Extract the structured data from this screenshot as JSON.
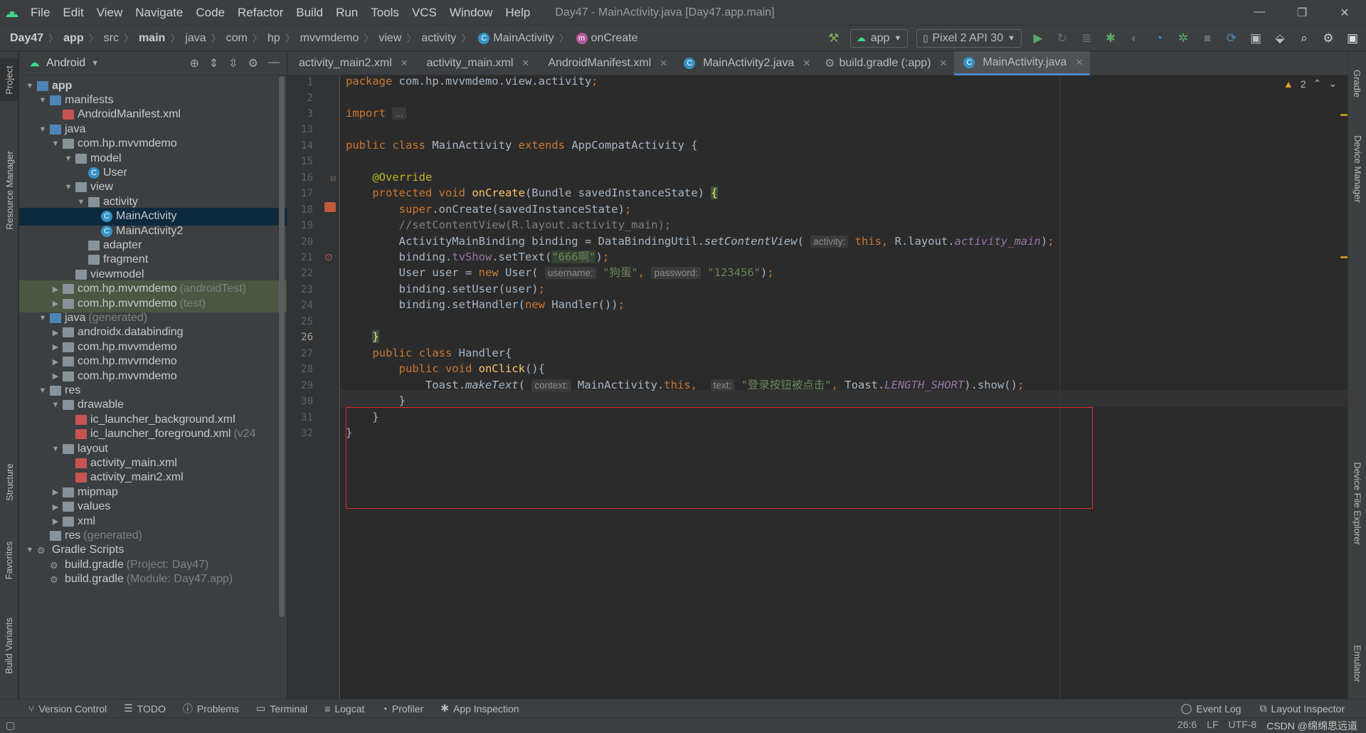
{
  "window": {
    "title": "Day47 - MainActivity.java [Day47.app.main]",
    "controls": [
      "—",
      "❐",
      "✕"
    ]
  },
  "menu": [
    "File",
    "Edit",
    "View",
    "Navigate",
    "Code",
    "Refactor",
    "Build",
    "Run",
    "Tools",
    "VCS",
    "Window",
    "Help"
  ],
  "breadcrumbs": [
    "Day47",
    "app",
    "src",
    "main",
    "java",
    "com",
    "hp",
    "mvvmdemo",
    "view",
    "activity",
    "MainActivity",
    "onCreate"
  ],
  "toolbar": {
    "run_config": "app",
    "device": "Pixel 2 API 30"
  },
  "project": {
    "view_mode": "Android",
    "tree": [
      {
        "label": "app",
        "type": "module",
        "indent": 0,
        "arrow": "open"
      },
      {
        "label": "manifests",
        "type": "folder-j",
        "indent": 1,
        "arrow": "open"
      },
      {
        "label": "AndroidManifest.xml",
        "type": "xml",
        "indent": 2,
        "arrow": ""
      },
      {
        "label": "java",
        "type": "folder-j",
        "indent": 1,
        "arrow": "open"
      },
      {
        "label": "com.hp.mvvmdemo",
        "type": "folder",
        "indent": 2,
        "arrow": "open"
      },
      {
        "label": "model",
        "type": "folder",
        "indent": 3,
        "arrow": "open"
      },
      {
        "label": "User",
        "type": "class",
        "indent": 4,
        "arrow": ""
      },
      {
        "label": "view",
        "type": "folder",
        "indent": 3,
        "arrow": "open"
      },
      {
        "label": "activity",
        "type": "folder",
        "indent": 4,
        "arrow": "open"
      },
      {
        "label": "MainActivity",
        "type": "class",
        "indent": 5,
        "arrow": "",
        "selected": true
      },
      {
        "label": "MainActivity2",
        "type": "class",
        "indent": 5,
        "arrow": ""
      },
      {
        "label": "adapter",
        "type": "folder",
        "indent": 4,
        "arrow": ""
      },
      {
        "label": "fragment",
        "type": "folder",
        "indent": 4,
        "arrow": ""
      },
      {
        "label": "viewmodel",
        "type": "folder",
        "indent": 3,
        "arrow": ""
      },
      {
        "label": "com.hp.mvvmdemo",
        "suffix": "(androidTest)",
        "type": "folder",
        "indent": 2,
        "arrow": "closed",
        "highlight": true
      },
      {
        "label": "com.hp.mvvmdemo",
        "suffix": "(test)",
        "type": "folder",
        "indent": 2,
        "arrow": "closed",
        "highlight": true
      },
      {
        "label": "java",
        "suffix": "(generated)",
        "type": "folder-j",
        "indent": 1,
        "arrow": "open"
      },
      {
        "label": "androidx.databinding",
        "type": "folder",
        "indent": 2,
        "arrow": "closed"
      },
      {
        "label": "com.hp.mvvmdemo",
        "type": "folder",
        "indent": 2,
        "arrow": "closed"
      },
      {
        "label": "com.hp.mvvmdemo",
        "type": "folder",
        "indent": 2,
        "arrow": "closed"
      },
      {
        "label": "com.hp.mvvmdemo",
        "type": "folder",
        "indent": 2,
        "arrow": "closed"
      },
      {
        "label": "res",
        "type": "folder",
        "indent": 1,
        "arrow": "open"
      },
      {
        "label": "drawable",
        "type": "folder",
        "indent": 2,
        "arrow": "open"
      },
      {
        "label": "ic_launcher_background.xml",
        "type": "xml",
        "indent": 3,
        "arrow": ""
      },
      {
        "label": "ic_launcher_foreground.xml",
        "suffix": "(v24",
        "type": "xml",
        "indent": 3,
        "arrow": ""
      },
      {
        "label": "layout",
        "type": "folder",
        "indent": 2,
        "arrow": "open"
      },
      {
        "label": "activity_main.xml",
        "type": "xml",
        "indent": 3,
        "arrow": ""
      },
      {
        "label": "activity_main2.xml",
        "type": "xml",
        "indent": 3,
        "arrow": ""
      },
      {
        "label": "mipmap",
        "type": "folder",
        "indent": 2,
        "arrow": "closed"
      },
      {
        "label": "values",
        "type": "folder",
        "indent": 2,
        "arrow": "closed"
      },
      {
        "label": "xml",
        "type": "folder",
        "indent": 2,
        "arrow": "closed"
      },
      {
        "label": "res",
        "suffix": "(generated)",
        "type": "folder",
        "indent": 1,
        "arrow": ""
      },
      {
        "label": "Gradle Scripts",
        "type": "gradle",
        "indent": 0,
        "arrow": "open"
      },
      {
        "label": "build.gradle",
        "suffix": "(Project: Day47)",
        "type": "gradle",
        "indent": 1,
        "arrow": ""
      },
      {
        "label": "build.gradle",
        "suffix": "(Module: Day47.app)",
        "type": "gradle",
        "indent": 1,
        "arrow": ""
      }
    ]
  },
  "tabs": [
    {
      "label": "activity_main2.xml",
      "icon": "xml"
    },
    {
      "label": "activity_main.xml",
      "icon": "xml"
    },
    {
      "label": "AndroidManifest.xml",
      "icon": "manifest"
    },
    {
      "label": "MainActivity2.java",
      "icon": "class"
    },
    {
      "label": "build.gradle (:app)",
      "icon": "gradle"
    },
    {
      "label": "MainActivity.java",
      "icon": "class",
      "active": true
    }
  ],
  "editor": {
    "warnings": "2",
    "line_numbers": [
      "1",
      "2",
      "3",
      "13",
      "14",
      "15",
      "16",
      "17",
      "18",
      "19",
      "20",
      "21",
      "22",
      "23",
      "24",
      "25",
      "26",
      "27",
      "28",
      "29",
      "30",
      "31",
      "32"
    ],
    "current_line": "26"
  },
  "left_strip": [
    "Project",
    "Resource Manager",
    "Structure",
    "Favorites",
    "Build Variants"
  ],
  "right_strip": [
    "Gradle",
    "Device Manager",
    "Device File Explorer",
    "Emulator"
  ],
  "bottom_tools": [
    "Version Control",
    "TODO",
    "Problems",
    "Terminal",
    "Logcat",
    "Profiler",
    "App Inspection"
  ],
  "bottom_right_tools": [
    "Event Log",
    "Layout Inspector"
  ],
  "status": {
    "position": "26:6",
    "line_sep": "LF",
    "encoding": "UTF-8",
    "watermark": "CSDN @绵绵思远道"
  }
}
